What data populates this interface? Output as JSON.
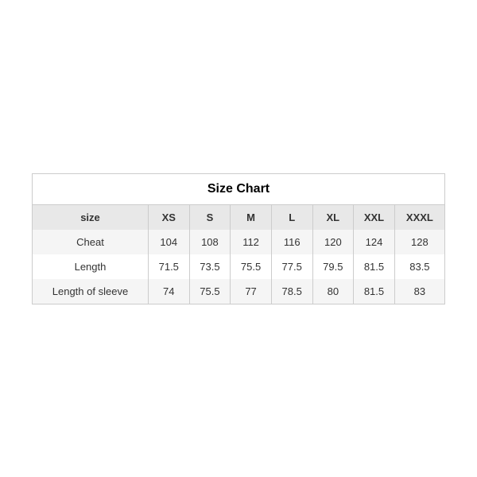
{
  "chart": {
    "title": "Size Chart",
    "headers": [
      "size",
      "XS",
      "S",
      "M",
      "L",
      "XL",
      "XXL",
      "XXXL"
    ],
    "rows": [
      {
        "label": "Cheat",
        "values": [
          "104",
          "108",
          "112",
          "116",
          "120",
          "124",
          "128"
        ]
      },
      {
        "label": "Length",
        "values": [
          "71.5",
          "73.5",
          "75.5",
          "77.5",
          "79.5",
          "81.5",
          "83.5"
        ]
      },
      {
        "label": "Length of sleeve",
        "values": [
          "74",
          "75.5",
          "77",
          "78.5",
          "80",
          "81.5",
          "83"
        ]
      }
    ]
  }
}
